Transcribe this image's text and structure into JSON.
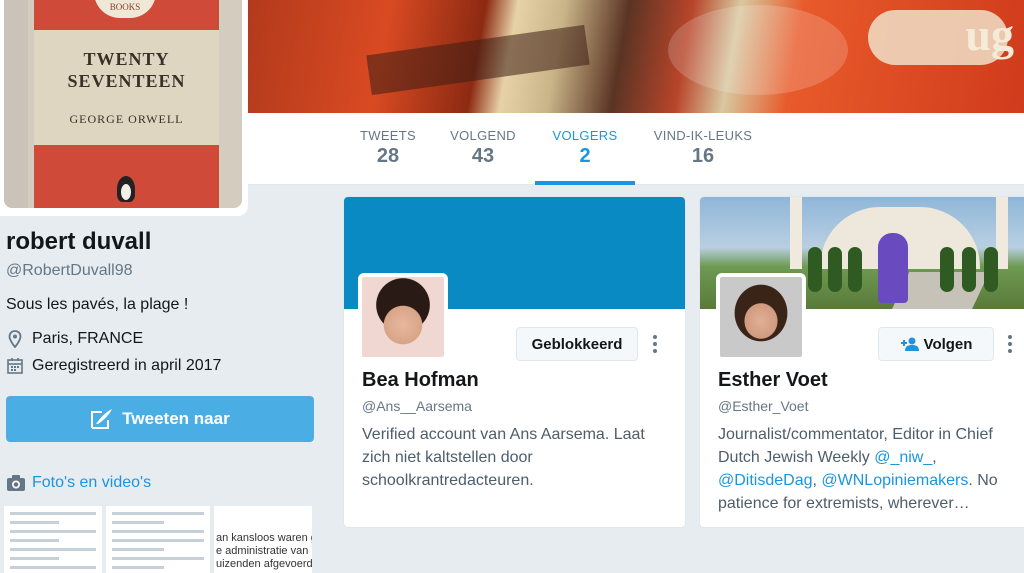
{
  "profile": {
    "book": {
      "publisher": "BOOKS",
      "title_line1": "TWENTY",
      "title_line2": "SEVENTEEN",
      "author": "GEORGE ORWELL"
    },
    "name": "robert duvall",
    "handle": "@RobertDuvall98",
    "bio": "Sous les pavés, la plage !",
    "location": "Paris, FRANCE",
    "joined": "Geregistreerd in april 2017",
    "tweet_button": "Tweeten naar",
    "media_link": "Foto's en video's",
    "media_thumb_text": [
      "an kansloos waren ge",
      "e administratie van",
      "uizenden afgevoerd"
    ]
  },
  "banner": {
    "word": "ug"
  },
  "nav": [
    {
      "label": "TWEETS",
      "value": "28"
    },
    {
      "label": "VOLGEND",
      "value": "43"
    },
    {
      "label": "VOLGERS",
      "value": "2"
    },
    {
      "label": "VIND-IK-LEUKS",
      "value": "16"
    }
  ],
  "active_tab": "VOLGERS",
  "cards": [
    {
      "name": "Bea Hofman",
      "handle": "@Ans__Aarsema",
      "button": "Geblokkeerd",
      "bio": "Verified account van Ans Aarsema. Laat zich niet kaltstellen door schoolkrantredacteuren."
    },
    {
      "name": "Esther Voet",
      "handle": "@Esther_Voet",
      "button": "Volgen",
      "bio_before": "Journalist/commentator, Editor in Chief Dutch Jewish Weekly ",
      "mention1": "@_niw_",
      "sep1": ", ",
      "mention2": "@DitisdeDag",
      "sep2": ", ",
      "mention3": "@WNLopiniemakers",
      "bio_after": ". No patience for extremists, wherever…"
    }
  ],
  "colors": {
    "accent": "#1b95e0",
    "tweet_button": "#4aaee5",
    "bea_header": "#0a8ac2",
    "background": "#e6ecf0"
  }
}
